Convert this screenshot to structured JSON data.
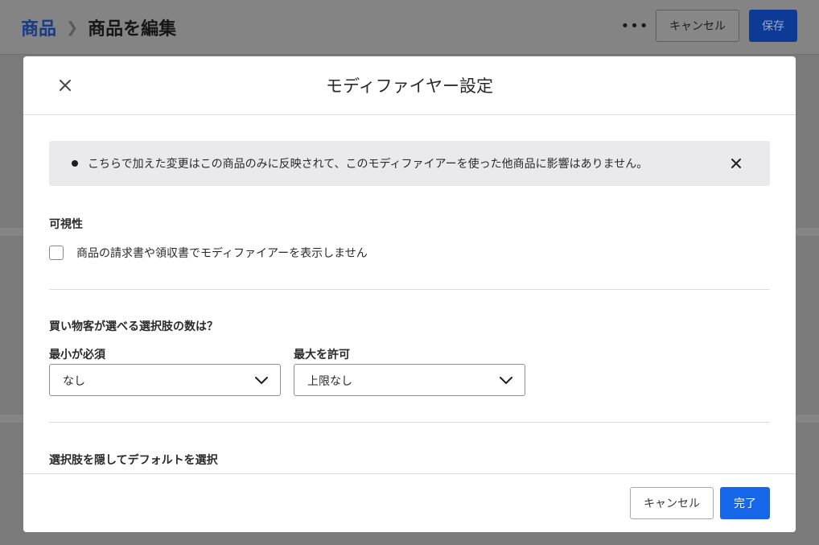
{
  "background": {
    "breadcrumb": {
      "parent": "商品",
      "current": "商品を編集"
    },
    "more_icon": "more-horizontal-icon",
    "cancel_label": "キャンセル",
    "save_label": "保存"
  },
  "modal": {
    "title": "モディファイヤー設定",
    "close_icon": "close-icon",
    "notice": {
      "text": "こちらで加えた変更はこの商品のみに反映されて、このモディファイアーを使った他商品に影響はありません。",
      "close_icon": "close-icon"
    },
    "visibility": {
      "label": "可視性",
      "checkbox_label": "商品の請求書や領収書でモディファイアーを表示しません",
      "checked": false
    },
    "selection": {
      "question": "買い物客が選べる選択肢の数は？",
      "min": {
        "label": "最小が必須",
        "value": "なし"
      },
      "max": {
        "label": "最大を許可",
        "value": "上限なし"
      }
    },
    "hide_default_label": "選択肢を隠してデフォルトを選択",
    "footer": {
      "cancel_label": "キャンセル",
      "done_label": "完了"
    }
  },
  "colors": {
    "primary": "#1666e9",
    "overlay": "#7a7a7a",
    "notice_bg": "#eaeaec"
  }
}
